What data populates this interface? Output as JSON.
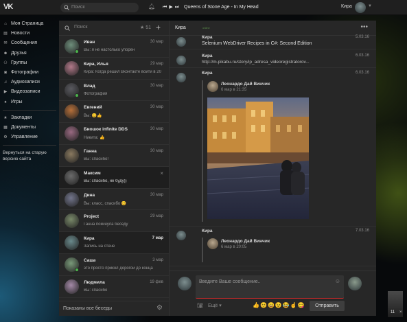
{
  "topbar": {
    "logo": "VK",
    "search_placeholder": "Поиск",
    "track": "Queens of Stone Age - In My Head",
    "user": "Кира"
  },
  "leftnav": {
    "items": [
      {
        "label": "Моя Страница",
        "icon": "home-icon"
      },
      {
        "label": "Новости",
        "icon": "news-icon"
      },
      {
        "label": "Сообщения",
        "icon": "messages-icon"
      },
      {
        "label": "Друзья",
        "icon": "friends-icon"
      },
      {
        "label": "Группы",
        "icon": "groups-icon"
      },
      {
        "label": "Фотографии",
        "icon": "photos-icon"
      },
      {
        "label": "Аудиозаписи",
        "icon": "audio-icon"
      },
      {
        "label": "Видеозаписи",
        "icon": "video-icon"
      },
      {
        "label": "Игры",
        "icon": "games-icon"
      }
    ],
    "items2": [
      {
        "label": "Закладки",
        "icon": "bookmarks-icon"
      },
      {
        "label": "Документы",
        "icon": "documents-icon"
      },
      {
        "label": "Управление",
        "icon": "manage-icon"
      }
    ],
    "old_version": "Вернуться на старую версию сайта"
  },
  "dialogs": {
    "search_placeholder": "Поиск",
    "starred": "51",
    "footer": "Показаны все беседы",
    "items": [
      {
        "name": "Иван",
        "date": "30 мар",
        "text": "Вы: я не настолько упорен",
        "online": true,
        "color": "#6f8f7c"
      },
      {
        "name": "Кира, Илья",
        "date": "29 мар",
        "text": "Кира: Когда решил Вконтакте войти в 20",
        "online": false,
        "color": "#b27a8a"
      },
      {
        "name": "Влад",
        "date": "30 мар",
        "text": "Фотография",
        "online": true,
        "color": "#5a5a60"
      },
      {
        "name": "Евгений",
        "date": "30 мар",
        "text": "Вы: 😊👍",
        "online": false,
        "color": "#b7703a"
      },
      {
        "name": "Биошок infinite DDS",
        "date": "30 мар",
        "text": "Никита: 👍",
        "online": false,
        "color": "#9a6a82"
      },
      {
        "name": "Ганна",
        "date": "30 мар",
        "text": "Вы: спасибо!",
        "online": false,
        "color": "#8a7a60"
      },
      {
        "name": "Максим",
        "date": "",
        "text": "Вы: спасибо, не буду))",
        "online": false,
        "color": "#6b6b6b",
        "active": true
      },
      {
        "name": "Дина",
        "date": "30 мар",
        "text": "Вы: класс, спасибо 😊",
        "online": false,
        "color": "#73768c"
      },
      {
        "name": "Project",
        "date": "29 мар",
        "text": "Ганна покинула беседу",
        "online": false,
        "color": "#7a8a6a"
      },
      {
        "name": "Кира",
        "date": "7 мар",
        "text": "Запись на стене",
        "online": false,
        "color": "#6a8a8c",
        "selected": true
      },
      {
        "name": "Саша",
        "date": "3 мар",
        "text": "это просто прикол дорогой до конца",
        "online": true,
        "color": "#7a9a7a"
      },
      {
        "name": "Людмила",
        "date": "19 фев",
        "text": "Вы: спасибо",
        "online": false,
        "color": "#a58aa8"
      }
    ]
  },
  "chat": {
    "name": "Кира",
    "status": "online",
    "messages": [
      {
        "name": "Кира",
        "date": "5.03.16",
        "text": "Selenium WebDriver Recipes in C#: Second Edition"
      },
      {
        "name": "Кира",
        "date": "6.03.16",
        "text": "http://m.pikabu.ru/story/ip_adresa_videoregistratorov..."
      },
      {
        "name": "Кира",
        "date": "6.03.16",
        "fw_name": "Леонардо Дай Винчик",
        "fw_time": "6 мар в 21:35"
      },
      {
        "name": "Кира",
        "date": "7.03.16",
        "fw_name": "Леонардо Дай Винчик",
        "fw_time": "6 мар в 20:05"
      }
    ],
    "input_placeholder": "Введите Ваше сообщение..",
    "more": "Ещё",
    "emojis": [
      "👍",
      "😊",
      "😀",
      "😉",
      "😂",
      "☝",
      "😋"
    ],
    "send": "Отправить"
  },
  "side": {
    "count": "11"
  }
}
